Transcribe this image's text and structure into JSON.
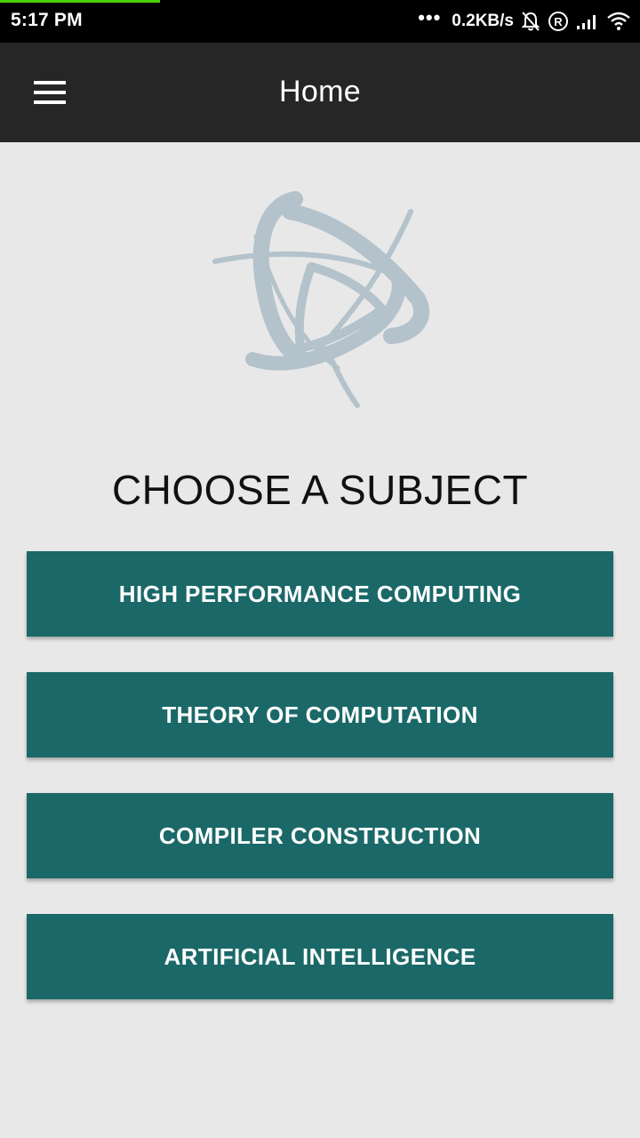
{
  "status_bar": {
    "time": "5:17 PM",
    "dots": "•••",
    "network_speed": "0.2KB/s",
    "icons": [
      "bell-off-icon",
      "registered-icon",
      "signal-icon",
      "wifi-icon"
    ],
    "progress": 0.25,
    "progress_color": "#4cd10f"
  },
  "app_bar": {
    "menu_icon": "hamburger-menu-icon",
    "title": "Home"
  },
  "logo": {
    "icon": "atom-star-logo",
    "color": "#b3c2cb"
  },
  "main": {
    "heading": "CHOOSE A SUBJECT",
    "subjects": [
      {
        "label": "HIGH PERFORMANCE COMPUTING"
      },
      {
        "label": "THEORY OF COMPUTATION"
      },
      {
        "label": "COMPILER CONSTRUCTION"
      },
      {
        "label": "ARTIFICIAL INTELLIGENCE"
      }
    ],
    "button_color": "#1b6868"
  }
}
